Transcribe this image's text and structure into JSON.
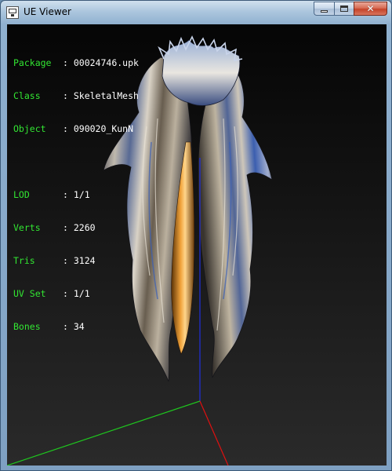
{
  "window": {
    "title": "UE Viewer",
    "controls": {
      "minimize": "minimize",
      "maximize": "maximize",
      "close": "✕"
    }
  },
  "info": {
    "object_rows": [
      {
        "label": "Package",
        "value": "00024746.upk"
      },
      {
        "label": "Class",
        "value": "SkeletalMesh"
      },
      {
        "label": "Object",
        "value": "090020_KunN"
      }
    ],
    "mesh_rows": [
      {
        "label": "LOD",
        "value": "1/1"
      },
      {
        "label": "Verts",
        "value": "2260"
      },
      {
        "label": "Tris",
        "value": "3124"
      },
      {
        "label": "UV Set",
        "value": "1/1"
      },
      {
        "label": "Bones",
        "value": "34"
      }
    ]
  },
  "colors": {
    "label_green": "#32e632",
    "axis_x": "#e01010",
    "axis_y": "#1ec81e",
    "axis_z": "#2030e0"
  }
}
